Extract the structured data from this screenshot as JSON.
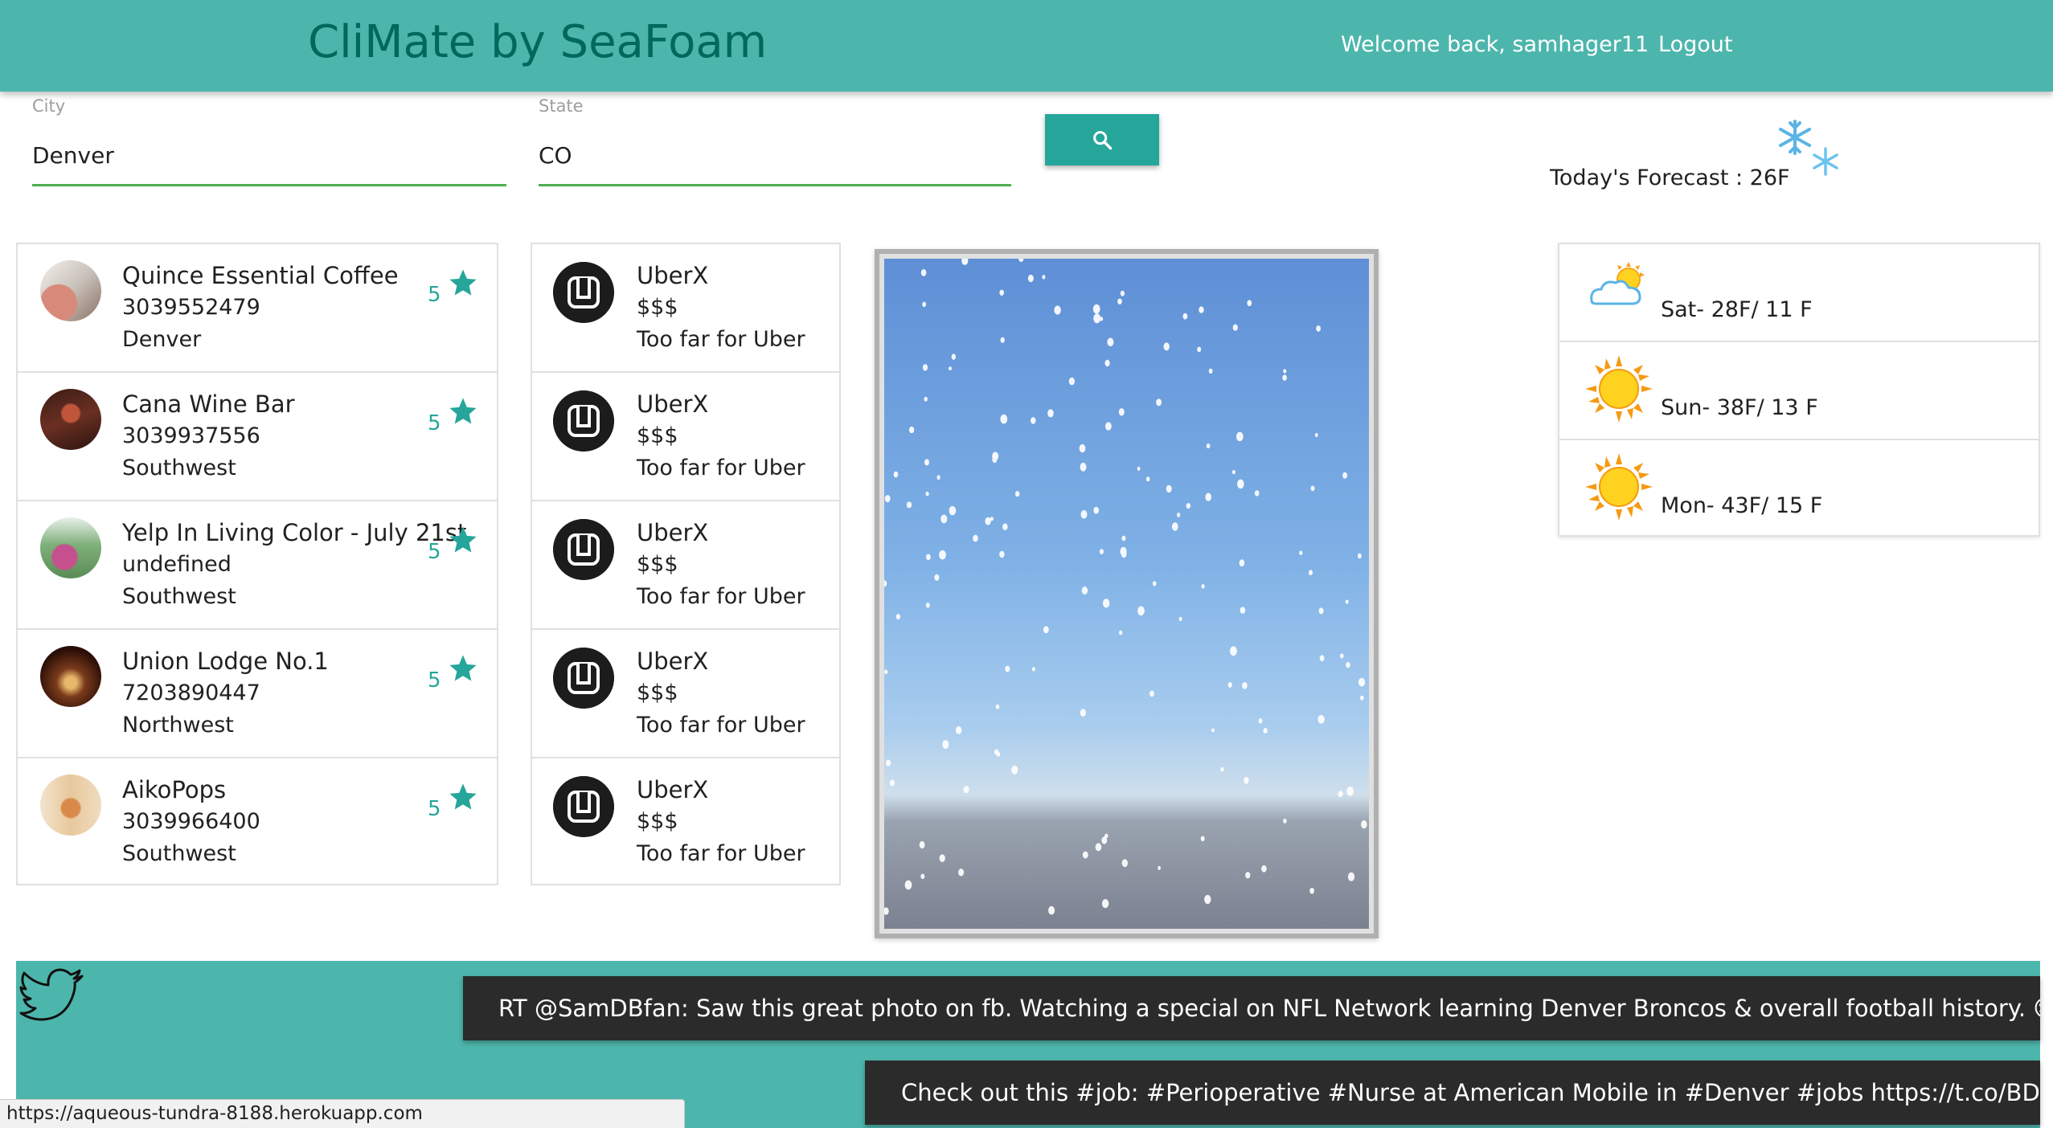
{
  "header": {
    "brand": "CliMate by SeaFoam",
    "welcome": "Welcome back, samhager11",
    "logout": "Logout"
  },
  "search": {
    "city_label": "City",
    "city_value": "Denver",
    "state_label": "State",
    "state_value": "CO",
    "button_icon": "search-icon"
  },
  "weather": {
    "today": "Today's Forecast : 26F",
    "today_icon": "snowflake-icon",
    "forecast": [
      {
        "text": "Sat- 28F/ 11 F",
        "icon": "partly-cloudy-icon"
      },
      {
        "text": "Sun- 38F/ 13 F",
        "icon": "sun-icon"
      },
      {
        "text": "Mon- 43F/ 15 F",
        "icon": "sun-icon"
      }
    ]
  },
  "places": [
    {
      "name": "Quince Essential Coffee",
      "phone": "3039552479",
      "area": "Denver",
      "rating": "5"
    },
    {
      "name": "Cana Wine Bar",
      "phone": "3039937556",
      "area": "Southwest",
      "rating": "5"
    },
    {
      "name": "Yelp In Living Color - July 21st",
      "phone": "undefined",
      "area": "Southwest",
      "rating": "5"
    },
    {
      "name": "Union Lodge No.1",
      "phone": "7203890447",
      "area": "Northwest",
      "rating": "5"
    },
    {
      "name": "AikoPops",
      "phone": "3039966400",
      "area": "Southwest",
      "rating": "5"
    }
  ],
  "rides": [
    {
      "name": "UberX",
      "price": "$$$",
      "eta": "Too far for Uber"
    },
    {
      "name": "UberX",
      "price": "$$$",
      "eta": "Too far for Uber"
    },
    {
      "name": "UberX",
      "price": "$$$",
      "eta": "Too far for Uber"
    },
    {
      "name": "UberX",
      "price": "$$$",
      "eta": "Too far for Uber"
    },
    {
      "name": "UberX",
      "price": "$$$",
      "eta": "Too far for Uber"
    }
  ],
  "tweets": [
    "RT @SamDBfan: Saw this great photo on fb. Watching a special on NFL Network learning Denver Broncos & overall football history. 😊  https://t…",
    "Check out this #job: #Perioperative #Nurse at American Mobile in #Denver #jobs https://t.co/BDfEADuBSt"
  ],
  "status_url": "https://aqueous-tundra-8188.herokuapp.com",
  "colors": {
    "header_bg": "#4db6ac",
    "brand_text": "#00695c",
    "accent": "#26a69a",
    "input_underline": "#4caf50",
    "tweet_bg": "#2b2b2b"
  }
}
